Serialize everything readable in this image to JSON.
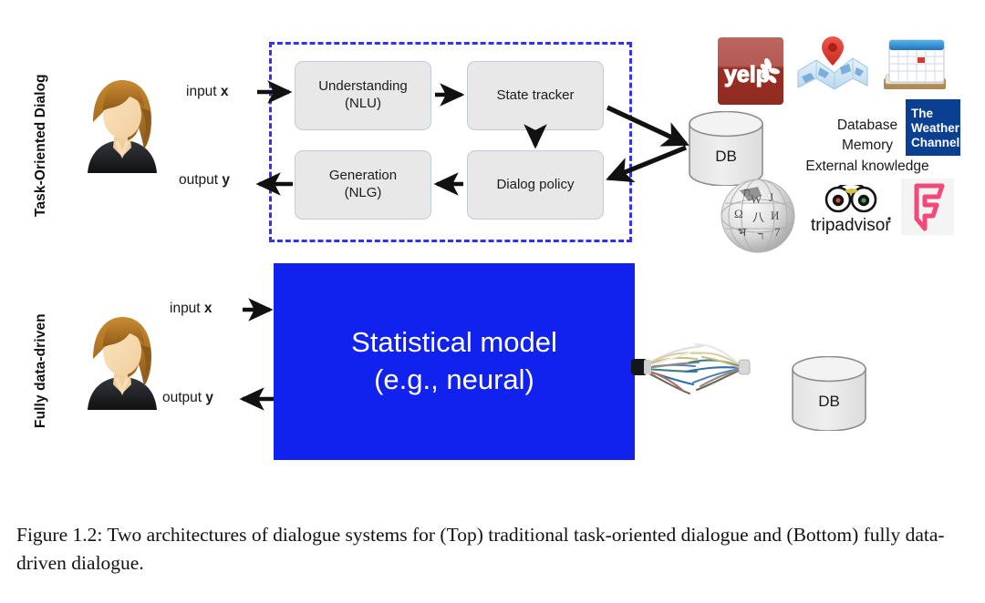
{
  "figure": {
    "caption": "Figure 1.2: Two architectures of dialogue systems for (Top) traditional task-oriented dialogue and (Bottom) fully data-driven dialogue.",
    "background_color": "#ffffff"
  },
  "rows": {
    "top": {
      "label": "Task-Oriented Dialog",
      "user_avatar_name": "user-avatar",
      "io": {
        "input_prefix": "input ",
        "input_symbol": "x",
        "output_prefix": "output ",
        "output_symbol": "y"
      },
      "frame": {
        "style": "dashed",
        "color": "#3333ee"
      },
      "modules": [
        {
          "id": "nlu",
          "line1": "Understanding",
          "line2": "(NLU)"
        },
        {
          "id": "state-tracker",
          "line1": "State tracker",
          "line2": ""
        },
        {
          "id": "nlg",
          "line1": "Generation",
          "line2": "(NLG)"
        },
        {
          "id": "dialog-policy",
          "line1": "Dialog policy",
          "line2": ""
        }
      ],
      "module_fill": "#e8e8e8",
      "database": {
        "label": "DB"
      },
      "knowledge_text": [
        "Database",
        "Memory",
        "External knowledge"
      ],
      "knowledge_icons": [
        {
          "name": "yelp-logo-icon",
          "label": "yelp",
          "color": "#af3b30"
        },
        {
          "name": "map-pin-icon",
          "label": "map",
          "color": "#2f7fd0"
        },
        {
          "name": "calendar-icon",
          "label": "calendar",
          "color": "#2e86c8"
        },
        {
          "name": "weather-channel-logo-icon",
          "label": "The Weather Channel",
          "color": "#0b3f91"
        },
        {
          "name": "wikipedia-globe-icon",
          "label": "Wikipedia",
          "color": "#cccccc"
        },
        {
          "name": "tripadvisor-logo-icon",
          "label": "tripadvisor",
          "color": "#1a1a1a"
        },
        {
          "name": "foursquare-logo-icon",
          "label": "Foursquare",
          "color": "#f14a78"
        }
      ]
    },
    "bottom": {
      "label": "Fully data-driven",
      "user_avatar_name": "user-avatar",
      "io": {
        "input_prefix": "input ",
        "input_symbol": "x",
        "output_prefix": "output ",
        "output_symbol": "y"
      },
      "model_box": {
        "line1": "Statistical model",
        "line2": "(e.g., neural)",
        "fill_color": "#1122ee",
        "text_color": "#ffffff"
      },
      "database": {
        "label": "DB"
      },
      "connector": "frayed-cable-bundle"
    }
  }
}
